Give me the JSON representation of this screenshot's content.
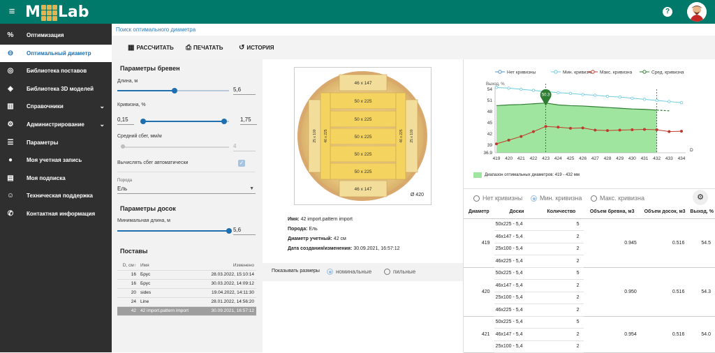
{
  "header": {
    "logo_left": "M",
    "logo_right": "Lab"
  },
  "sidebar": {
    "items": [
      {
        "label": "Оптимизация",
        "icon": "percent-icon"
      },
      {
        "label": "Оптимальный диаметр",
        "icon": "diameter-icon"
      },
      {
        "label": "Библиотека поставов",
        "icon": "target-icon"
      },
      {
        "label": "Библиотека 3D моделей",
        "icon": "cube-icon"
      },
      {
        "label": "Справочники",
        "icon": "library-icon"
      },
      {
        "label": "Администрирование",
        "icon": "gear-icon"
      },
      {
        "label": "Параметры",
        "icon": "sliders-icon"
      },
      {
        "label": "Моя учетная запись",
        "icon": "person-icon"
      },
      {
        "label": "Моя подписка",
        "icon": "document-icon"
      },
      {
        "label": "Техническая поддержка",
        "icon": "support-icon"
      },
      {
        "label": "Контактная информация",
        "icon": "phone-icon"
      }
    ]
  },
  "breadcrumb": "Поиск оптимального диаметра",
  "toolbar": {
    "calculate": "РАССЧИТАТЬ",
    "print": "ПЕЧАТАТЬ",
    "history": "ИСТОРИЯ"
  },
  "params": {
    "logs_title": "Параметры бревен",
    "length_label": "Длина, м",
    "length_value": "5,6",
    "curvature_label": "Кривизна, %",
    "curvature_min": "0,15",
    "curvature_max": "1,75",
    "taper_label": "Средний сбег, мм/м",
    "taper_value": "4",
    "auto_taper_label": "Вычислять сбег автоматически",
    "species_label": "Порода",
    "species_value": "Ель",
    "boards_title": "Параметры досок",
    "min_length_label": "Минимальная длина, м",
    "min_length_value": "5,6",
    "postavs_title": "Поставы",
    "postav_headers": [
      "D, см",
      "Имя",
      "Изменено"
    ],
    "postavs": [
      {
        "d": "16",
        "name": "Брус",
        "changed": "28.03.2022, 15:10:14"
      },
      {
        "d": "16",
        "name": "Брус",
        "changed": "30.03.2022, 14:09:12"
      },
      {
        "d": "20",
        "name": "sides",
        "changed": "19.04.2022, 14:11:30"
      },
      {
        "d": "24",
        "name": "Line",
        "changed": "28.01.2022, 14:56:20"
      },
      {
        "d": "42",
        "name": "42 import.pattern import",
        "changed": "30.09.2021, 16:57:12"
      }
    ]
  },
  "pattern": {
    "boards": [
      "46 x 147",
      "50 x 225",
      "50 x 225",
      "50 x 225",
      "50 x 225",
      "50 x 225",
      "46 x 147"
    ],
    "side_left_outer": "25 x 100",
    "side_left_inner": "46 x 225",
    "side_right_inner": "46 x 225",
    "side_right_outer": "25 x 100",
    "diameter_label": "Ø 420",
    "info": {
      "name_label": "Имя:",
      "name_value": "42 import.pattern import",
      "species_label": "Порода:",
      "species_value": "Ель",
      "diameter_label": "Диаметр учетный:",
      "diameter_value": "42 см",
      "date_label": "Дата создания/изменения:",
      "date_value": "30.09.2021, 16:57:12"
    },
    "show_sizes_label": "Показывать размеры",
    "nominal": "номинальные",
    "sawn": "пильные"
  },
  "chart_data": {
    "type": "line",
    "ylabel": "Выход, %",
    "xlabel": "D",
    "x": [
      419,
      420,
      421,
      422,
      423,
      424,
      425,
      426,
      427,
      428,
      429,
      430,
      431,
      432,
      433,
      434
    ],
    "ylim": [
      36.9,
      54
    ],
    "yticks": [
      "54",
      "51",
      "48",
      "45",
      "42",
      "39",
      "36.9"
    ],
    "series": [
      {
        "name": "Нет кривизны",
        "color": "#4f90c9",
        "values": [
          null,
          null,
          null,
          null,
          null,
          null,
          null,
          null,
          null,
          null,
          null,
          null,
          null,
          null,
          null,
          null
        ]
      },
      {
        "name": "Мин. кривизна",
        "color": "#6ccbe0",
        "values": [
          54.5,
          54.3,
          54.0,
          53.7,
          53.4,
          53.1,
          52.9,
          52.6,
          52.4,
          52.1,
          51.9,
          51.6,
          51.3,
          51.0,
          50.7,
          50.4
        ]
      },
      {
        "name": "Макс. кривизна",
        "color": "#c0392b",
        "values": [
          39.3,
          40.3,
          41.3,
          42.6,
          44.0,
          43.8,
          43.5,
          43.6,
          43.0,
          42.9,
          43.0,
          43.1,
          43.2,
          43.1,
          42.6,
          42.7
        ]
      },
      {
        "name": "Сред. кривизна",
        "color": "#2e7d32",
        "values": [
          49.6,
          49.8,
          49.9,
          50.1,
          50.3,
          49.8,
          49.6,
          49.5,
          49.3,
          49.1,
          48.9,
          48.7,
          48.6,
          48.4,
          48.2,
          null
        ]
      }
    ],
    "marker": {
      "x": 423,
      "label": "50.3"
    },
    "range": [
      419,
      432
    ],
    "range_legend": "Диапазон оптимальных диаметров: 419 - 432 мм"
  },
  "curvature_options": [
    "Нет кривизны",
    "Мин. кривизна",
    "Макс. кривизна"
  ],
  "results": {
    "headers": [
      "Диаметр",
      "Доски",
      "Количество",
      "Объем бревна, м3",
      "Объем досок, м3",
      "Выход, %"
    ],
    "groups": [
      {
        "diameter": "419",
        "vlog": "0.945",
        "vboards": "0.516",
        "yield": "54.5",
        "rows": [
          {
            "b": "50x225 - 5,4",
            "q": "5"
          },
          {
            "b": "46x147 - 5,4",
            "q": "2"
          },
          {
            "b": "25x100 - 5,4",
            "q": "2"
          },
          {
            "b": "46x225 - 5,4",
            "q": "2"
          }
        ]
      },
      {
        "diameter": "420",
        "vlog": "0.950",
        "vboards": "0.516",
        "yield": "54.3",
        "rows": [
          {
            "b": "50x225 - 5,4",
            "q": "5"
          },
          {
            "b": "46x147 - 5,4",
            "q": "2"
          },
          {
            "b": "25x100 - 5,4",
            "q": "2"
          },
          {
            "b": "46x225 - 5,4",
            "q": "2"
          }
        ]
      },
      {
        "diameter": "421",
        "vlog": "0.954",
        "vboards": "0.516",
        "yield": "54.0",
        "rows": [
          {
            "b": "50x225 - 5,4",
            "q": "5"
          },
          {
            "b": "46x147 - 5,4",
            "q": "2"
          },
          {
            "b": "25x100 - 5,4",
            "q": "2"
          }
        ]
      }
    ]
  }
}
